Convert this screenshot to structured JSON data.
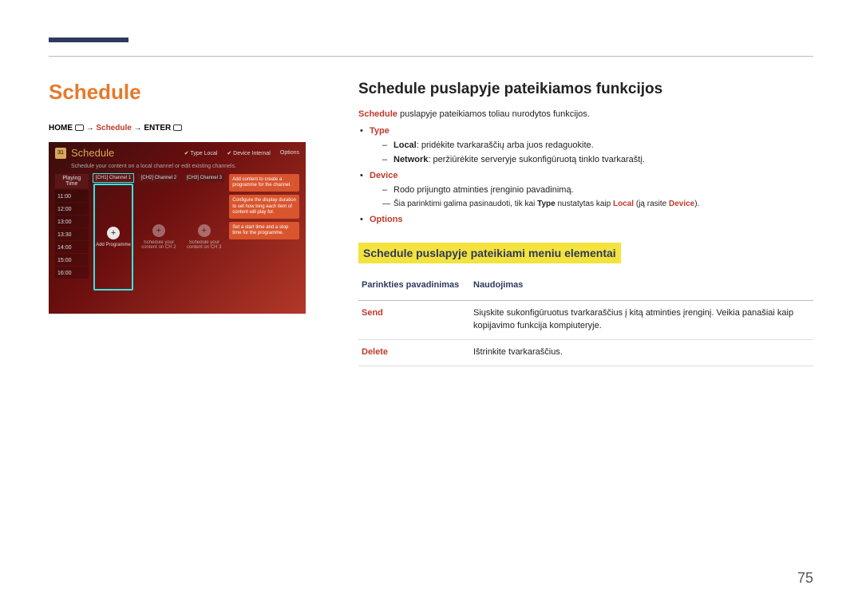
{
  "page": {
    "title": "Schedule",
    "number": "75"
  },
  "breadcrumb": {
    "home": "HOME",
    "schedule": "Schedule",
    "enter": "ENTER",
    "arrow": "→"
  },
  "mockup": {
    "cal_icon_text": "31",
    "title": "Schedule",
    "subtitle": "Schedule your content on a local channel or edit existing channels.",
    "top_right": {
      "type_label": "Type",
      "type_value": "Local",
      "device_label": "Device",
      "device_value": "Internal",
      "options": "Options"
    },
    "time_header": "Playing Time",
    "times": [
      "11:00",
      "12:00",
      "13:00",
      "13:30",
      "14:00",
      "15:00",
      "16:00"
    ],
    "channels": [
      {
        "header": "[CH1] Channel 1",
        "label": "Add Programme"
      },
      {
        "header": "[CH2] Channel 2",
        "label": "Schedule your content on CH 2"
      },
      {
        "header": "[CH3] Channel 3",
        "label": "Schedule your content on CH 3"
      }
    ],
    "hints": [
      "Add content to create a programme for the channel.",
      "Configure the display duration to set how long each item of content will play for.",
      "Set a start time and a stop time for the programme."
    ]
  },
  "content": {
    "h2": "Schedule puslapyje pateikiamos funkcijos",
    "intro_prefix": "Schedule",
    "intro_rest": " puslapyje pateikiamos toliau nurodytos funkcijos.",
    "items": [
      {
        "name": "Type",
        "subs": [
          {
            "bold": "Local",
            "text": ": pridėkite tvarkaraščių arba juos redaguokite."
          },
          {
            "bold": "Network",
            "text": ": peržiūrėkite serveryje sukonfigūruotą tinklo tvarkaraštį."
          }
        ]
      },
      {
        "name": "Device",
        "subs": [
          {
            "bold": "",
            "text": "Rodo prijungto atminties įrenginio pavadinimą."
          }
        ],
        "note": {
          "pre": "Šia parinktimi galima pasinaudoti, tik kai ",
          "b1": "Type",
          "mid": " nustatytas kaip ",
          "b2": "Local",
          "mid2": " (ją rasite ",
          "b3": "Device",
          "post": ")."
        }
      },
      {
        "name": "Options",
        "subs": []
      }
    ],
    "subheader": "Schedule puslapyje pateikiami meniu elementai",
    "table": {
      "col1": "Parinkties pavadinimas",
      "col2": "Naudojimas",
      "rows": [
        {
          "name": "Send",
          "desc": "Siųskite sukonfigūruotus tvarkaraščius į kitą atminties įrenginį. Veikia panašiai kaip kopijavimo funkcija kompiuteryje."
        },
        {
          "name": "Delete",
          "desc": "Ištrinkite tvarkaraščius."
        }
      ]
    }
  }
}
